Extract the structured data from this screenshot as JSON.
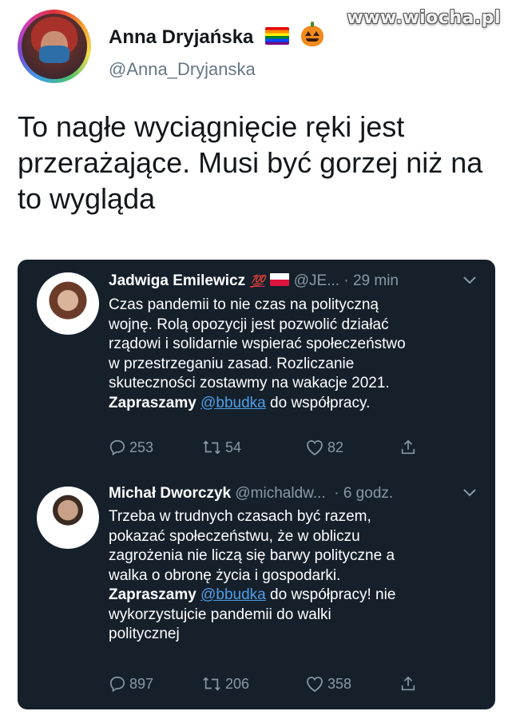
{
  "watermark": "www.wiocha.pl",
  "main_tweet": {
    "author_name": "Anna Dryjańska",
    "author_handle": "@Anna_Dryjanska",
    "flag_icon": "rainbow-flag-icon",
    "emoji_icon": "pumpkin-icon",
    "text": "To nagłe wyciągnięcie ręki jest przerażające. Musi być gorzej niż na to wygląda"
  },
  "embedded": [
    {
      "author_name": "Jadwiga Emilewicz",
      "emoji": "💯",
      "handle": "@JE...",
      "time": "· 29 min",
      "text_lines": [
        "Czas pandemii to nie czas na polityczną",
        "wojnę. Rolą opozycji jest pozwolić działać",
        "rządowi i solidarnie wspierać społeczeństwo",
        "w przestrzeganiu zasad. Rozliczanie",
        "skuteczności zostawmy na wakacje 2021."
      ],
      "cta_bold": "Zapraszamy",
      "mention": "@bbudka",
      "cta_rest": "do współpracy.",
      "replies": "253",
      "retweets": "54",
      "likes": "82"
    },
    {
      "author_name": "Michał Dworczyk",
      "handle": "@michaldw...",
      "time": "· 6 godz.",
      "text_lines": [
        "Trzeba w trudnych czasach być razem,",
        "pokazać społeczeństwu, że w obliczu",
        "zagrożenia nie liczą się barwy polityczne a",
        "walka o obronę życia i gospodarki."
      ],
      "cta_bold": "Zapraszamy",
      "mention": "@bbudka",
      "cta_rest": "do współpracy! nie",
      "text_after": [
        "wykorzystujcie pandemii do walki",
        "politycznej"
      ],
      "replies": "897",
      "retweets": "206",
      "likes": "358"
    }
  ],
  "colors": {
    "card_bg": "#15202b",
    "muted": "#8899a6",
    "link": "#4d9ee8"
  }
}
